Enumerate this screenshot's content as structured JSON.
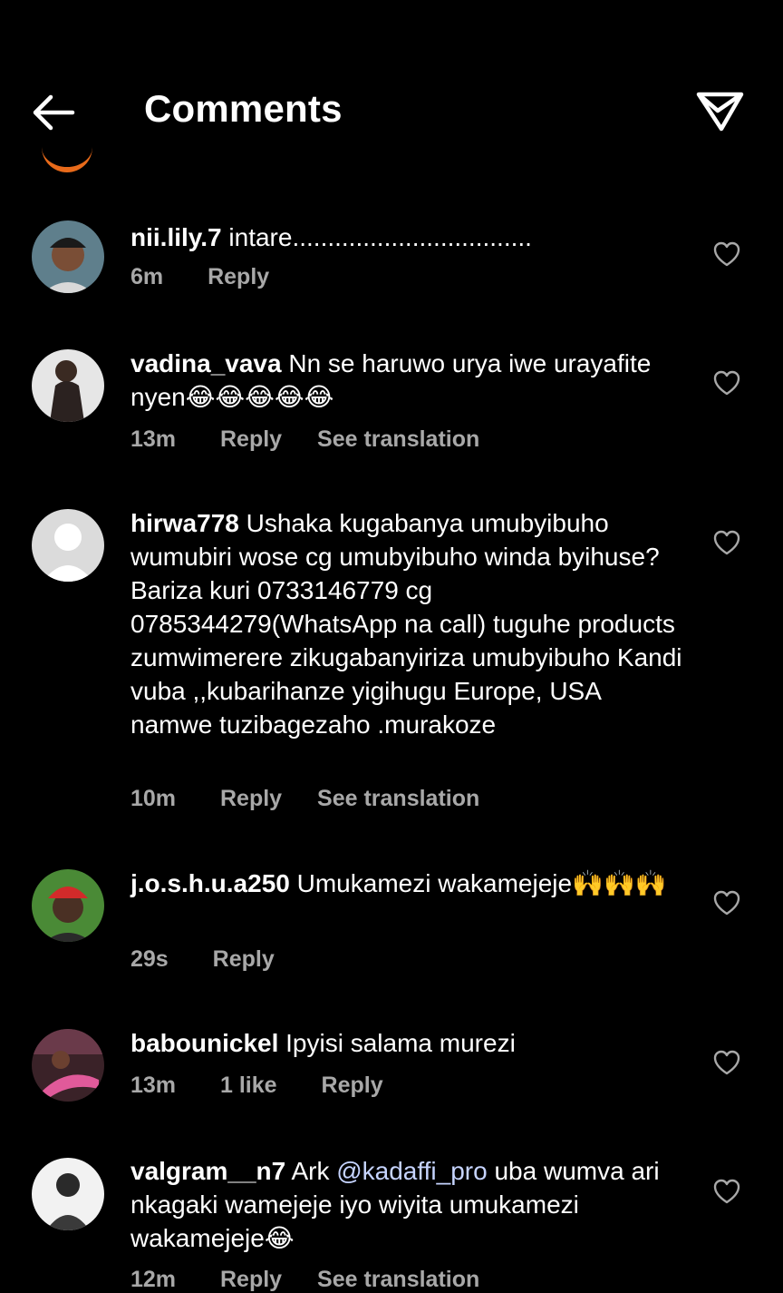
{
  "header": {
    "title": "Comments"
  },
  "comments": [
    {
      "username": "nii.lily.7",
      "text": "intare..................................",
      "time": "6m",
      "likes": "",
      "reply": "Reply",
      "translate": "",
      "avatar_color": "#6b8a9a"
    },
    {
      "username": "vadina_vava",
      "text": "Nn se haruwo urya iwe urayafite nyen😂😂😂😂😂",
      "time": "13m",
      "likes": "",
      "reply": "Reply",
      "translate": "See translation",
      "avatar_color": "#9a9a9a"
    },
    {
      "username": "hirwa778",
      "text": "Ushaka kugabanya umubyibuho wumubiri wose cg umubyibuho winda byihuse? Bariza kuri 0733146779 cg 0785344279(WhatsApp na call) tuguhe products zumwimerere zikugabanyiriza umubyibuho  Kandi vuba ,,kubarihanze yigihugu Europe, USA namwe tuzibagezaho .murakoze",
      "time": "10m",
      "likes": "",
      "reply": "Reply",
      "translate": "See translation",
      "avatar_color": "#dbdbdb"
    },
    {
      "username": "j.o.s.h.u.a250",
      "text": "Umukamezi wakamejeje🙌🙌🙌",
      "time": "29s",
      "likes": "",
      "reply": "Reply",
      "translate": "",
      "avatar_color": "#4e8a3a"
    },
    {
      "username": "babounickel",
      "text": "Ipyisi salama murezi",
      "time": "13m",
      "likes": "1 like",
      "reply": "Reply",
      "translate": "",
      "avatar_color": "#5a2a3a"
    },
    {
      "username": "valgram__n7",
      "text_before": "Ark ",
      "mention": "@kadaffi_pro",
      "text_after": "  uba wumva ari nkagaki wamejeje iyo wiyita umukamezi wakamejeje😂",
      "time": "12m",
      "likes": "",
      "reply": "Reply",
      "translate": "See translation",
      "avatar_color": "#777777"
    }
  ]
}
